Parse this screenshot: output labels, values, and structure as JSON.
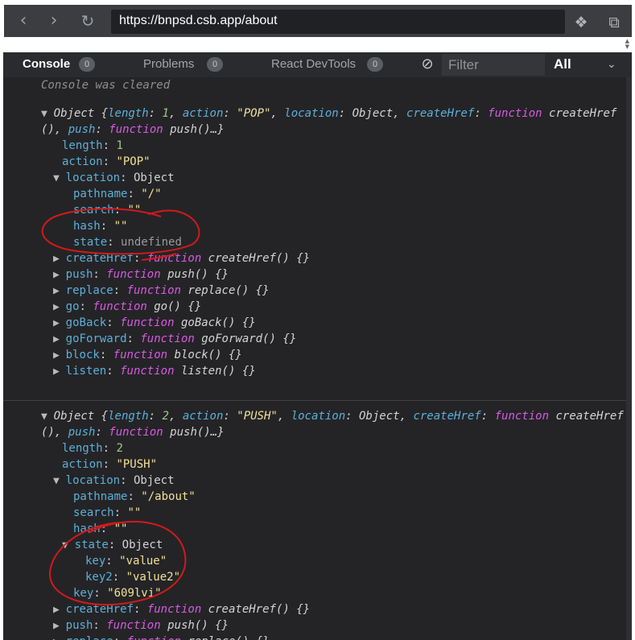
{
  "browser": {
    "url": "https://bnpsd.csb.app/about"
  },
  "devtools": {
    "tabs": [
      {
        "label": "Console",
        "count": "0",
        "active": true
      },
      {
        "label": "Problems",
        "count": "0"
      },
      {
        "label": "React DevTools",
        "count": "0"
      }
    ],
    "filter_placeholder": "Filter",
    "level": "All"
  },
  "console": {
    "cleared": "Console was cleared",
    "entries": [
      {
        "summary": [
          {
            "c": "ob",
            "t": "Object {"
          },
          {
            "c": "k",
            "t": "length"
          },
          {
            "c": "ob",
            "t": ": "
          },
          {
            "c": "n",
            "t": "1"
          },
          {
            "c": "ob",
            "t": ", "
          },
          {
            "c": "k",
            "t": "action"
          },
          {
            "c": "ob",
            "t": ": "
          },
          {
            "c": "s",
            "t": "\"POP\""
          },
          {
            "c": "ob",
            "t": ", "
          },
          {
            "c": "k",
            "t": "location"
          },
          {
            "c": "ob",
            "t": ": Object, "
          },
          {
            "c": "k",
            "t": "createHref"
          },
          {
            "c": "ob",
            "t": ": "
          },
          {
            "c": "f",
            "t": "function"
          },
          {
            "c": "fn",
            "t": " createHref"
          }
        ],
        "summary2": [
          {
            "c": "fn",
            "t": "(), "
          },
          {
            "c": "k",
            "t": "push"
          },
          {
            "c": "ob",
            "t": ": "
          },
          {
            "c": "f",
            "t": "function"
          },
          {
            "c": "fn",
            "t": " push()…}"
          }
        ],
        "props": [
          {
            "ind": 2,
            "tri": "",
            "parts": [
              {
                "c": "k",
                "t": "length"
              },
              {
                "c": "ob",
                "t": ": "
              },
              {
                "c": "n",
                "t": "1"
              }
            ]
          },
          {
            "ind": 2,
            "tri": "",
            "parts": [
              {
                "c": "k",
                "t": "action"
              },
              {
                "c": "ob",
                "t": ": "
              },
              {
                "c": "s",
                "t": "\"POP\""
              }
            ]
          },
          {
            "ind": 1,
            "tri": "▼",
            "parts": [
              {
                "c": "k",
                "t": "location"
              },
              {
                "c": "ob",
                "t": ": Object"
              }
            ]
          },
          {
            "ind": 3,
            "tri": "",
            "parts": [
              {
                "c": "k",
                "t": "pathname"
              },
              {
                "c": "ob",
                "t": ": "
              },
              {
                "c": "s",
                "t": "\"/\""
              }
            ]
          },
          {
            "ind": 3,
            "tri": "",
            "parts": [
              {
                "c": "k",
                "t": "search"
              },
              {
                "c": "ob",
                "t": ": "
              },
              {
                "c": "s",
                "t": "\"\""
              }
            ]
          },
          {
            "ind": 3,
            "tri": "",
            "parts": [
              {
                "c": "k",
                "t": "hash"
              },
              {
                "c": "ob",
                "t": ": "
              },
              {
                "c": "s",
                "t": "\"\""
              }
            ]
          },
          {
            "ind": 3,
            "tri": "",
            "parts": [
              {
                "c": "k",
                "t": "state"
              },
              {
                "c": "ob",
                "t": ": "
              },
              {
                "c": "u",
                "t": "undefined"
              }
            ]
          },
          {
            "ind": 1,
            "tri": "▶",
            "parts": [
              {
                "c": "k",
                "t": "createHref"
              },
              {
                "c": "ob",
                "t": ": "
              },
              {
                "c": "f",
                "t": "function"
              },
              {
                "c": "fn",
                "t": " createHref() {}"
              }
            ]
          },
          {
            "ind": 1,
            "tri": "▶",
            "parts": [
              {
                "c": "k",
                "t": "push"
              },
              {
                "c": "ob",
                "t": ": "
              },
              {
                "c": "f",
                "t": "function"
              },
              {
                "c": "fn",
                "t": " push() {}"
              }
            ]
          },
          {
            "ind": 1,
            "tri": "▶",
            "parts": [
              {
                "c": "k",
                "t": "replace"
              },
              {
                "c": "ob",
                "t": ": "
              },
              {
                "c": "f",
                "t": "function"
              },
              {
                "c": "fn",
                "t": " replace() {}"
              }
            ]
          },
          {
            "ind": 1,
            "tri": "▶",
            "parts": [
              {
                "c": "k",
                "t": "go"
              },
              {
                "c": "ob",
                "t": ": "
              },
              {
                "c": "f",
                "t": "function"
              },
              {
                "c": "fn",
                "t": " go() {}"
              }
            ]
          },
          {
            "ind": 1,
            "tri": "▶",
            "parts": [
              {
                "c": "k",
                "t": "goBack"
              },
              {
                "c": "ob",
                "t": ": "
              },
              {
                "c": "f",
                "t": "function"
              },
              {
                "c": "fn",
                "t": " goBack() {}"
              }
            ]
          },
          {
            "ind": 1,
            "tri": "▶",
            "parts": [
              {
                "c": "k",
                "t": "goForward"
              },
              {
                "c": "ob",
                "t": ": "
              },
              {
                "c": "f",
                "t": "function"
              },
              {
                "c": "fn",
                "t": " goForward() {}"
              }
            ]
          },
          {
            "ind": 1,
            "tri": "▶",
            "parts": [
              {
                "c": "k",
                "t": "block"
              },
              {
                "c": "ob",
                "t": ": "
              },
              {
                "c": "f",
                "t": "function"
              },
              {
                "c": "fn",
                "t": " block() {}"
              }
            ]
          },
          {
            "ind": 1,
            "tri": "▶",
            "parts": [
              {
                "c": "k",
                "t": "listen"
              },
              {
                "c": "ob",
                "t": ": "
              },
              {
                "c": "f",
                "t": "function"
              },
              {
                "c": "fn",
                "t": " listen() {}"
              }
            ]
          }
        ]
      },
      {
        "summary": [
          {
            "c": "ob",
            "t": "Object {"
          },
          {
            "c": "k",
            "t": "length"
          },
          {
            "c": "ob",
            "t": ": "
          },
          {
            "c": "n",
            "t": "2"
          },
          {
            "c": "ob",
            "t": ", "
          },
          {
            "c": "k",
            "t": "action"
          },
          {
            "c": "ob",
            "t": ": "
          },
          {
            "c": "s",
            "t": "\"PUSH\""
          },
          {
            "c": "ob",
            "t": ", "
          },
          {
            "c": "k",
            "t": "location"
          },
          {
            "c": "ob",
            "t": ": Object, "
          },
          {
            "c": "k",
            "t": "createHref"
          },
          {
            "c": "ob",
            "t": ": "
          },
          {
            "c": "f",
            "t": "function"
          },
          {
            "c": "fn",
            "t": " createHref"
          }
        ],
        "summary2": [
          {
            "c": "fn",
            "t": "(), "
          },
          {
            "c": "k",
            "t": "push"
          },
          {
            "c": "ob",
            "t": ": "
          },
          {
            "c": "f",
            "t": "function"
          },
          {
            "c": "fn",
            "t": " push()…}"
          }
        ],
        "props": [
          {
            "ind": 2,
            "tri": "",
            "parts": [
              {
                "c": "k",
                "t": "length"
              },
              {
                "c": "ob",
                "t": ": "
              },
              {
                "c": "n",
                "t": "2"
              }
            ]
          },
          {
            "ind": 2,
            "tri": "",
            "parts": [
              {
                "c": "k",
                "t": "action"
              },
              {
                "c": "ob",
                "t": ": "
              },
              {
                "c": "s",
                "t": "\"PUSH\""
              }
            ]
          },
          {
            "ind": 1,
            "tri": "▼",
            "parts": [
              {
                "c": "k",
                "t": "location"
              },
              {
                "c": "ob",
                "t": ": Object"
              }
            ]
          },
          {
            "ind": 3,
            "tri": "",
            "parts": [
              {
                "c": "k",
                "t": "pathname"
              },
              {
                "c": "ob",
                "t": ": "
              },
              {
                "c": "s",
                "t": "\"/about\""
              }
            ]
          },
          {
            "ind": 3,
            "tri": "",
            "parts": [
              {
                "c": "k",
                "t": "search"
              },
              {
                "c": "ob",
                "t": ": "
              },
              {
                "c": "s",
                "t": "\"\""
              }
            ]
          },
          {
            "ind": 3,
            "tri": "",
            "parts": [
              {
                "c": "k",
                "t": "hash"
              },
              {
                "c": "ob",
                "t": ": "
              },
              {
                "c": "s",
                "t": "\"\""
              }
            ]
          },
          {
            "ind": 2,
            "tri": "▼",
            "parts": [
              {
                "c": "k",
                "t": "state"
              },
              {
                "c": "ob",
                "t": ": Object"
              }
            ]
          },
          {
            "ind": 4,
            "tri": "",
            "parts": [
              {
                "c": "k",
                "t": "key"
              },
              {
                "c": "ob",
                "t": ": "
              },
              {
                "c": "s",
                "t": "\"value\""
              }
            ]
          },
          {
            "ind": 4,
            "tri": "",
            "parts": [
              {
                "c": "k",
                "t": "key2"
              },
              {
                "c": "ob",
                "t": ": "
              },
              {
                "c": "s",
                "t": "\"value2\""
              }
            ]
          },
          {
            "ind": 3,
            "tri": "",
            "parts": [
              {
                "c": "k",
                "t": "key"
              },
              {
                "c": "ob",
                "t": ": "
              },
              {
                "c": "s",
                "t": "\"609lvi\""
              }
            ]
          },
          {
            "ind": 1,
            "tri": "▶",
            "parts": [
              {
                "c": "k",
                "t": "createHref"
              },
              {
                "c": "ob",
                "t": ": "
              },
              {
                "c": "f",
                "t": "function"
              },
              {
                "c": "fn",
                "t": " createHref() {}"
              }
            ]
          },
          {
            "ind": 1,
            "tri": "▶",
            "parts": [
              {
                "c": "k",
                "t": "push"
              },
              {
                "c": "ob",
                "t": ": "
              },
              {
                "c": "f",
                "t": "function"
              },
              {
                "c": "fn",
                "t": " push() {}"
              }
            ]
          },
          {
            "ind": 1,
            "tri": "▶",
            "parts": [
              {
                "c": "k",
                "t": "replace"
              },
              {
                "c": "ob",
                "t": ": "
              },
              {
                "c": "f",
                "t": "function"
              },
              {
                "c": "fn",
                "t": " replace() {}"
              }
            ]
          }
        ]
      }
    ]
  }
}
